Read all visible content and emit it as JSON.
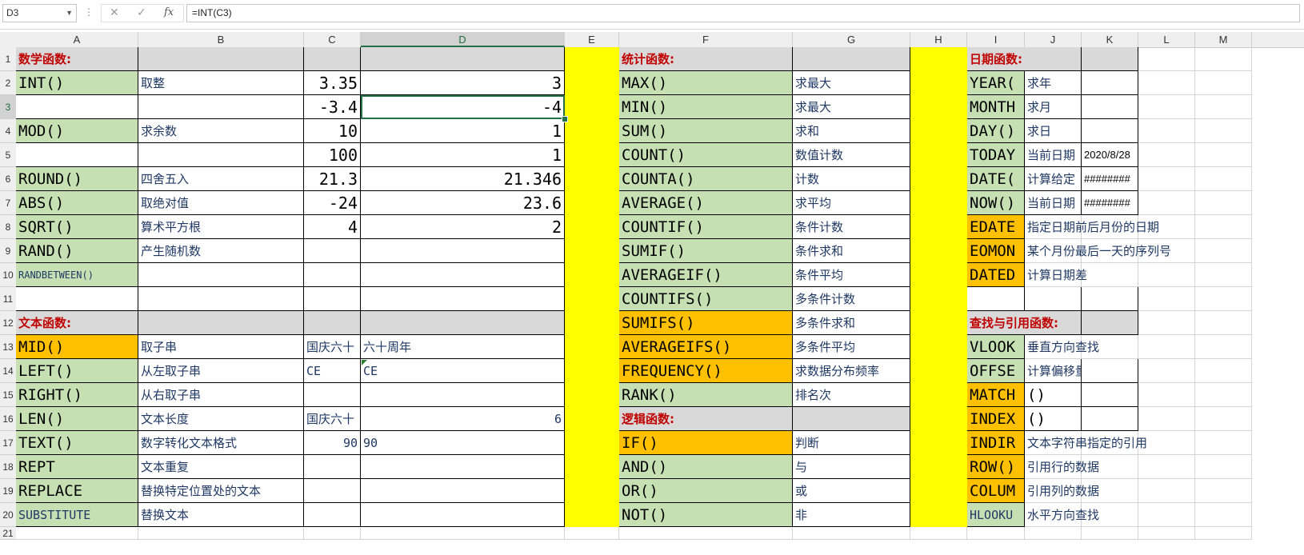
{
  "formula_bar": {
    "name_box": "D3",
    "formula": "=INT(C3)",
    "fx_label": "fx",
    "cancel_symbol": "✕",
    "enter_symbol": "✓"
  },
  "columns": [
    "A",
    "B",
    "C",
    "D",
    "E",
    "F",
    "G",
    "H",
    "I",
    "J",
    "K",
    "L",
    "M"
  ],
  "rows": [
    "1",
    "2",
    "3",
    "4",
    "5",
    "6",
    "7",
    "8",
    "9",
    "10",
    "11",
    "12",
    "13",
    "14",
    "15",
    "16",
    "17",
    "18",
    "19",
    "20",
    "21"
  ],
  "colors": {
    "green": "#c6e0b4",
    "orange": "#ffc000",
    "yellow": "#ffff00",
    "gray": "#d9d9d9",
    "section_red": "#c00000",
    "select_green": "#217346"
  },
  "math": {
    "title": "数学函数:",
    "rows": [
      {
        "fn": "INT()",
        "desc": "取整",
        "c": "3.35",
        "d": "3"
      },
      {
        "fn": "",
        "desc": "",
        "c": "-3.4",
        "d": "-4"
      },
      {
        "fn": "MOD()",
        "desc": "求余数",
        "c": "10",
        "d": "1"
      },
      {
        "fn": "",
        "desc": "",
        "c": "100",
        "d": "1"
      },
      {
        "fn": "ROUND()",
        "desc": "四舍五入",
        "c": "21.3",
        "d": "21.346"
      },
      {
        "fn": "ABS()",
        "desc": "取绝对值",
        "c": "-24",
        "d": "23.6"
      },
      {
        "fn": "SQRT()",
        "desc": "算术平方根",
        "c": "4",
        "d": "2"
      },
      {
        "fn": "RAND()",
        "desc": "产生随机数",
        "c": "",
        "d": ""
      },
      {
        "fn": "RANDBETWEEN()",
        "desc": "",
        "c": "",
        "d": ""
      }
    ]
  },
  "text": {
    "title": "文本函数:",
    "rows": [
      {
        "fn": "MID()",
        "desc": "取子串",
        "c": "国庆六十",
        "d": "六十周年"
      },
      {
        "fn": "LEFT()",
        "desc": "从左取子串",
        "c": "CE",
        "d": "CE"
      },
      {
        "fn": "RIGHT()",
        "desc": "从右取子串",
        "c": "",
        "d": ""
      },
      {
        "fn": "LEN()",
        "desc": "文本长度",
        "c": "国庆六十",
        "d": "6"
      },
      {
        "fn": "TEXT()",
        "desc": "数字转化文本格式",
        "c": "90",
        "d": "90"
      },
      {
        "fn": "REPT",
        "desc": "文本重复",
        "c": "",
        "d": ""
      },
      {
        "fn": "REPLACE",
        "desc": "替换特定位置处的文本",
        "c": "",
        "d": ""
      },
      {
        "fn": "SUBSTITUTE",
        "desc": "替换文本",
        "c": "",
        "d": ""
      }
    ]
  },
  "stats": {
    "title": "统计函数:",
    "rows": [
      {
        "fn": "MAX()",
        "desc": "求最大"
      },
      {
        "fn": "MIN()",
        "desc": "求最大"
      },
      {
        "fn": "SUM()",
        "desc": "求和"
      },
      {
        "fn": "COUNT()",
        "desc": "数值计数"
      },
      {
        "fn": "COUNTA()",
        "desc": "计数"
      },
      {
        "fn": "AVERAGE()",
        "desc": "求平均"
      },
      {
        "fn": "COUNTIF()",
        "desc": "条件计数"
      },
      {
        "fn": "SUMIF()",
        "desc": "条件求和"
      },
      {
        "fn": "AVERAGEIF()",
        "desc": "条件平均"
      },
      {
        "fn": "COUNTIFS()",
        "desc": "多条件计数"
      },
      {
        "fn": "SUMIFS()",
        "desc": "多条件求和"
      },
      {
        "fn": "AVERAGEIFS()",
        "desc": "多条件平均"
      },
      {
        "fn": "FREQUENCY()",
        "desc": "求数据分布频率"
      },
      {
        "fn": "RANK()",
        "desc": "排名次"
      }
    ]
  },
  "logic": {
    "title": "逻辑函数:",
    "rows": [
      {
        "fn": "IF()",
        "desc": "判断"
      },
      {
        "fn": "AND()",
        "desc": "与"
      },
      {
        "fn": "OR()",
        "desc": "或"
      },
      {
        "fn": "NOT()",
        "desc": "非"
      }
    ]
  },
  "date": {
    "title": "日期函数:",
    "rows": [
      {
        "fn": "YEAR(",
        "desc": "求年",
        "k": ""
      },
      {
        "fn": "MONTH",
        "desc": "求月",
        "k": ""
      },
      {
        "fn": "DAY()",
        "desc": "求日",
        "k": ""
      },
      {
        "fn": "TODAY",
        "desc": "当前日期",
        "k": "2020/8/28"
      },
      {
        "fn": "DATE(",
        "desc": "计算给定",
        "k": "########"
      },
      {
        "fn": "NOW()",
        "desc": "当前日期",
        "k": "########"
      },
      {
        "fn": "EDATE",
        "desc": "指定日期前后月份的日期",
        "k": ""
      },
      {
        "fn": "EOMON",
        "desc": "某个月份最后一天的序列号",
        "k": ""
      },
      {
        "fn": "DATED",
        "desc": "计算日期差",
        "k": ""
      }
    ]
  },
  "lookup": {
    "title": "查找与引用函数:",
    "rows": [
      {
        "fn": "VLOOK",
        "desc": "垂直方向查找"
      },
      {
        "fn": "OFFSE",
        "desc": "计算偏移量"
      },
      {
        "fn": "MATCH",
        "desc": "()"
      },
      {
        "fn": "INDEX",
        "desc": "()"
      },
      {
        "fn": "INDIR",
        "desc": "文本字符串指定的引用"
      },
      {
        "fn": "ROW()",
        "desc": "引用行的数据"
      },
      {
        "fn": "COLUM",
        "desc": "引用列的数据"
      },
      {
        "fn": "HLOOKU",
        "desc": "水平方向查找"
      }
    ]
  }
}
